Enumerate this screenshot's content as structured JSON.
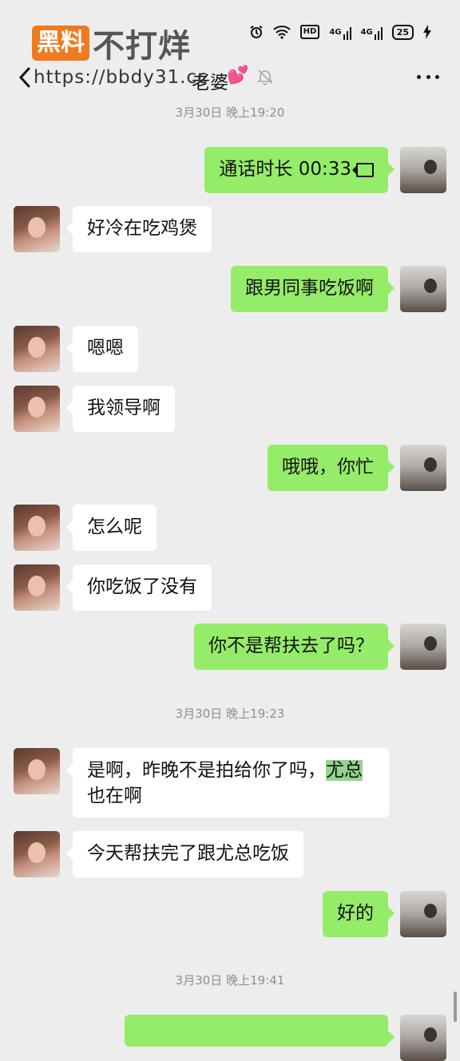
{
  "status_bar": {
    "alarm_icon": "alarm-icon",
    "wifi_icon": "wifi-icon",
    "hd_label": "HD",
    "sig1_label": "4G",
    "sig2_label": "4G",
    "battery": "25",
    "charge_icon": "bolt-icon"
  },
  "watermark": {
    "badge": "黑料",
    "rest": "不打烊",
    "url": "https://bbdy31.cc"
  },
  "header": {
    "title": "老婆",
    "heart": "💕"
  },
  "timestamps": [
    "3月30日 晚上19:20",
    "3月30日 晚上19:23",
    "3月30日 晚上19:41"
  ],
  "messages": [
    {
      "from": "me",
      "text": "通话时长 00:33"
    },
    {
      "from": "wife",
      "text": "好冷在吃鸡煲"
    },
    {
      "from": "me",
      "text": "跟男同事吃饭啊"
    },
    {
      "from": "wife",
      "text": "嗯嗯"
    },
    {
      "from": "wife",
      "text": "我领导啊"
    },
    {
      "from": "me",
      "text": "哦哦，你忙"
    },
    {
      "from": "wife",
      "text": "怎么呢"
    },
    {
      "from": "wife",
      "text": "你吃饭了没有"
    },
    {
      "from": "me",
      "text": "你不是帮扶去了吗？"
    },
    {
      "from": "wife",
      "text_a": "是啊，昨晚不是拍给你了吗，",
      "text_highlight": "尤总",
      "text_b": "也在啊"
    },
    {
      "from": "wife",
      "text": "今天帮扶完了跟尤总吃饭"
    },
    {
      "from": "me",
      "text": "好的"
    }
  ],
  "colors": {
    "background": "#ededed",
    "my_bubble": "#95ec69",
    "their_bubble": "#ffffff",
    "timestamp": "#8f8f8f",
    "watermark_badge": "#f07a1e"
  }
}
